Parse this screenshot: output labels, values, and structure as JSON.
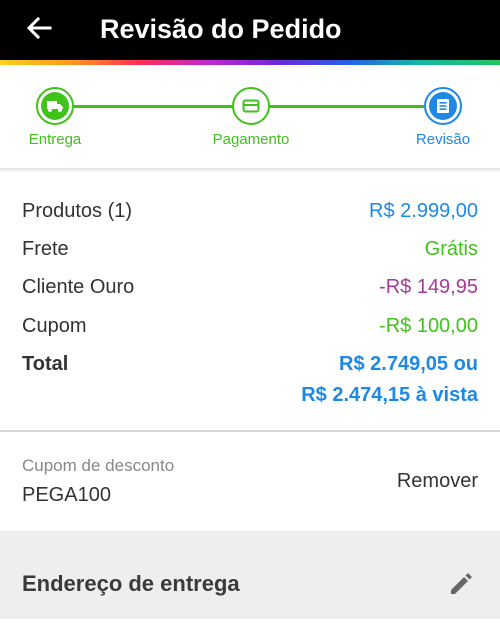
{
  "header": {
    "title": "Revisão do Pedido"
  },
  "steps": [
    {
      "label": "Entrega",
      "icon": "truck-icon",
      "color": "#3fc21a",
      "active": false
    },
    {
      "label": "Pagamento",
      "icon": "card-icon",
      "color": "#3fc21a",
      "active": false
    },
    {
      "label": "Revisão",
      "icon": "list-icon",
      "color": "#1e88e5",
      "active": true
    }
  ],
  "summary": {
    "products": {
      "label": "Produtos (1)",
      "value": "R$ 2.999,00",
      "color": "#1e88e5"
    },
    "shipping": {
      "label": "Frete",
      "value": "Grátis",
      "color": "#3fc21a"
    },
    "gold": {
      "label": "Cliente Ouro",
      "value": "-R$ 149,95",
      "color": "#a23aa0"
    },
    "coupon": {
      "label": "Cupom",
      "value": "-R$ 100,00",
      "color": "#3fc21a"
    },
    "total": {
      "label": "Total",
      "value_line1": "R$ 2.749,05 ou",
      "value_line2": "R$ 2.474,15 à vista",
      "color": "#1e88e5"
    }
  },
  "coupon_box": {
    "caption": "Cupom de desconto",
    "code": "PEGA100",
    "remove_label": "Remover"
  },
  "address": {
    "heading": "Endereço de entrega",
    "edit_icon": "pencil-icon"
  }
}
